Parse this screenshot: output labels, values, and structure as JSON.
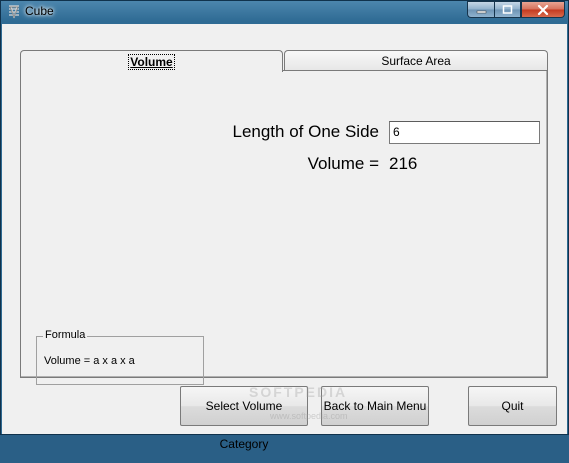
{
  "window": {
    "title": "Cube"
  },
  "tabs": [
    {
      "label": "Volume",
      "active": true
    },
    {
      "label": "Surface Area",
      "active": false
    }
  ],
  "volume_tab": {
    "side_label": "Length of One Side",
    "side_value": "6",
    "volume_label": "Volume =",
    "volume_value": "216",
    "formula": {
      "legend": "Formula",
      "text": "Volume = a x a x a"
    }
  },
  "buttons": {
    "select_category": "Select Volume Category",
    "back_to_main": "Back to Main Menu",
    "quit": "Quit"
  },
  "watermark": {
    "brand": "SOFTPEDIA",
    "url": "www.softpedia.com"
  },
  "icons": {
    "app": "cube-app-icon",
    "minimize": "minimize-icon",
    "maximize": "maximize-icon",
    "close": "close-icon"
  }
}
